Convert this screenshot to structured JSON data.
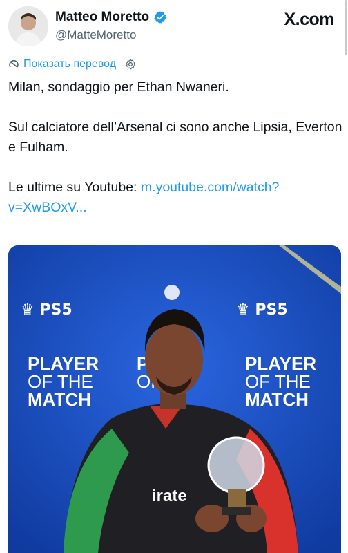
{
  "author": {
    "display_name": "Matteo Moretto",
    "handle": "@MatteMoretto",
    "verified": true
  },
  "brand": "X.com",
  "translate_label": "Показать перевод",
  "tweet": {
    "line1": "Milan, sondaggio per Ethan Nwaneri.",
    "line2": "Sul calciatore dell’Arsenal ci sono anche Lipsia, Everton e Fulham.",
    "line3_prefix": "Le ultime su Youtube: ",
    "link_text": "m.youtube.com/watch?v=XwBOxV..."
  },
  "media": {
    "backdrop_logo": "PS5",
    "backdrop_title_lines": [
      "PLAYER",
      "OF THE",
      "MATCH"
    ],
    "shirt_text": "irate"
  },
  "colors": {
    "accent": "#1d9bf0",
    "verified": "#1d9bf0",
    "backdrop": "#1546b8"
  }
}
